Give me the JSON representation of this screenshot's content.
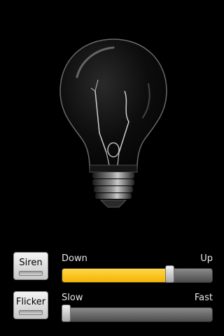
{
  "controls": {
    "siren_label": "Siren",
    "flicker_label": "Flicker"
  },
  "volume_slider": {
    "min_label": "Down",
    "max_label": "Up",
    "value": 0.73,
    "fill_color": "#f5b400"
  },
  "speed_slider": {
    "min_label": "Slow",
    "max_label": "Fast",
    "value": 0.0
  },
  "bulb": {
    "icon": "light-bulb-icon",
    "state": "off"
  }
}
